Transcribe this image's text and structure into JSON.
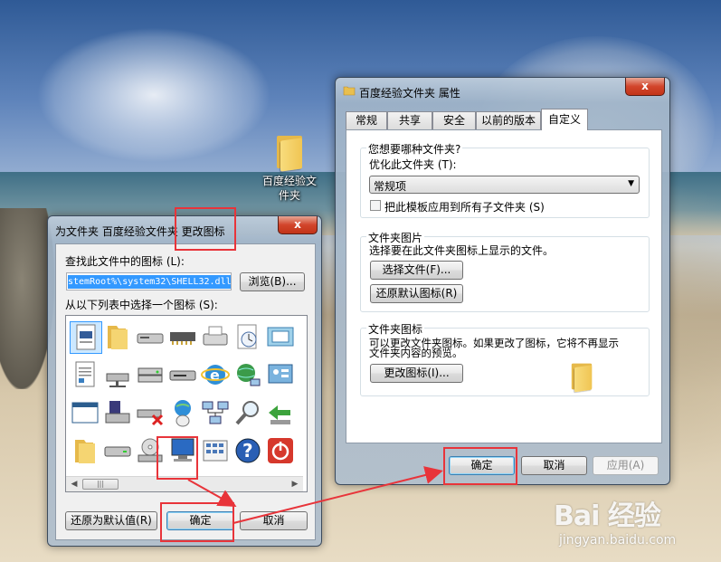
{
  "desktop": {
    "folder_label": "百度经验文件夹"
  },
  "change_icon_dialog": {
    "title": "为文件夹 百度经验文件夹 更改图标",
    "close_glyph": "x",
    "search_label": "查找此文件中的图标 (L):",
    "path_value": "stemRoot%\\system32\\SHELL32.dll",
    "browse_label": "浏览(B)...",
    "list_label": "从以下列表中选择一个图标 (S):",
    "restore_label": "还原为默认值(R)",
    "ok_label": "确定",
    "cancel_label": "取消",
    "scroll_thumb": "|||",
    "scroll_left": "◀",
    "scroll_right": "▶",
    "icons": [
      [
        "document-icon",
        "folder-icon",
        "drive-icon",
        "memory-chip-icon",
        "printer-icon",
        "clock-icon",
        "monitor-window-icon"
      ],
      [
        "text-document-icon",
        "network-drive-icon",
        "server-icon",
        "disk-drive-icon",
        "internet-explorer-icon",
        "network-globe-icon",
        "control-panel-icon",
        "display-settings-icon"
      ],
      [
        "window-icon",
        "floppy-icon",
        "network-drive-error-icon",
        "mouse-globe-icon",
        "network-computers-icon",
        "search-magnifier-icon",
        "green-arrow-icon"
      ],
      [
        "folder-icon",
        "hard-drive-icon",
        "cd-drive-icon",
        "computer-monitor-icon",
        "calculator-icon",
        "help-icon",
        "shutdown-icon"
      ]
    ],
    "selected_icon": "computer-monitor-icon"
  },
  "properties_dialog": {
    "title": "百度经验文件夹 属性",
    "close_glyph": "x",
    "tabs": [
      "常规",
      "共享",
      "安全",
      "以前的版本",
      "自定义"
    ],
    "active_tab": "自定义",
    "group1_title": "您想要哪种文件夹?",
    "optimize_label": "优化此文件夹 (T):",
    "optimize_value": "常规项",
    "apply_subfolders_label": "把此模板应用到所有子文件夹 (S)",
    "group2_title": "文件夹图片",
    "group2_desc": "选择要在此文件夹图标上显示的文件。",
    "choose_file_label": "选择文件(F)...",
    "restore_default_label": "还原默认图标(R)",
    "group3_title": "文件夹图标",
    "group3_desc_line1": "可以更改文件夹图标。如果更改了图标，它将不再显示",
    "group3_desc_line2": "文件夹内容的预览。",
    "change_icon_label": "更改图标(I)...",
    "ok_label": "确定",
    "cancel_label": "取消",
    "apply_label": "应用(A)"
  },
  "watermark": {
    "brand": "Bai 经验",
    "url": "jingyan.baidu.com"
  },
  "colors": {
    "highlight": "#e8343a",
    "accent_blue": "#3399ff"
  }
}
